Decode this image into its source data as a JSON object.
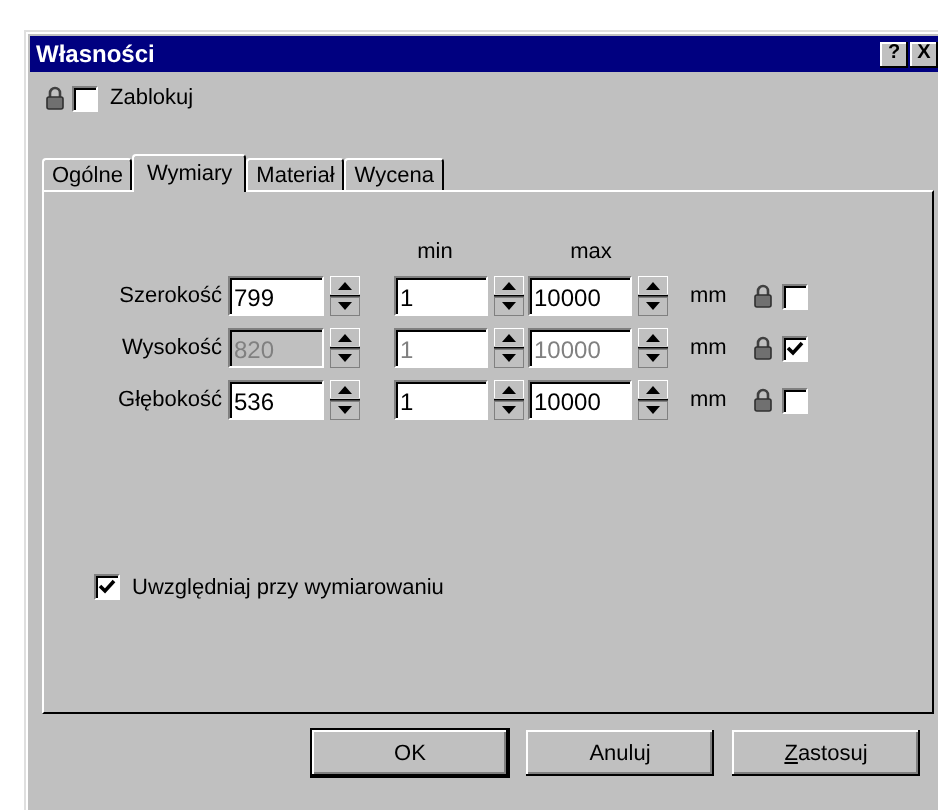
{
  "window": {
    "title": "Własności",
    "title_buttons": [
      "?",
      "X"
    ]
  },
  "lock": {
    "label": "Zablokuj",
    "checked": false
  },
  "tabs": [
    {
      "label": "Ogólne",
      "selected": false
    },
    {
      "label": "Wymiary",
      "selected": true
    },
    {
      "label": "Materiał",
      "selected": false
    },
    {
      "label": "Wycena",
      "selected": false
    }
  ],
  "columns": {
    "min": "min",
    "max": "max"
  },
  "rows": [
    {
      "label": "Szerokość",
      "value": "799",
      "min": "1",
      "max": "10000",
      "unit": "mm",
      "disabled": false,
      "locked": false
    },
    {
      "label": "Wysokość",
      "value": "820",
      "min": "1",
      "max": "10000",
      "unit": "mm",
      "disabled": true,
      "locked": true
    },
    {
      "label": "Głębokość",
      "value": "536",
      "min": "1",
      "max": "10000",
      "unit": "mm",
      "disabled": false,
      "locked": false
    }
  ],
  "include": {
    "label": "Uwzględniaj przy wymiarowaniu",
    "checked": true
  },
  "buttons": [
    {
      "label": "OK",
      "default": true
    },
    {
      "label": "Anuluj",
      "default": false
    },
    {
      "label": "Zastosuj",
      "default": false
    }
  ]
}
